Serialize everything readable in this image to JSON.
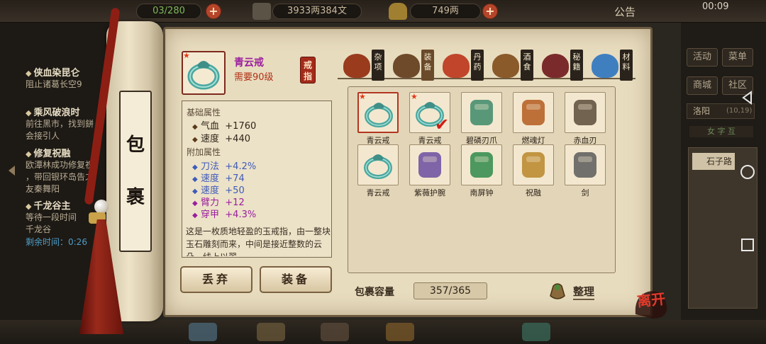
{
  "topbar": {
    "pill1_value": "03/280",
    "money": "3933两384文",
    "gold": "749两",
    "notice": "公告",
    "time": "00:09"
  },
  "quests": [
    {
      "title": "侠血染昆仑",
      "lines": [
        "阻止诸葛长空9"
      ]
    },
    {
      "title": "乘风破浪时",
      "lines": [
        "前往黑市，找到鉼",
        "会接引人"
      ]
    },
    {
      "title": "修复祝融",
      "lines": [
        "欧潭林成功修复祝",
        "，带回银环岛告之",
        "友秦舞阳"
      ]
    },
    {
      "title": "千龙谷主",
      "lines": [
        "等待一段时间",
        "千龙谷"
      ],
      "remain": "剩余时间：0:26"
    }
  ],
  "right_panel": {
    "buttons": [
      "活动",
      "菜单",
      "商城",
      "社区"
    ],
    "location": "洛阳",
    "coords": "(10,19)",
    "tabs": "女 字 互",
    "road": "石子路"
  },
  "scroll": {
    "chars": [
      "包",
      "裹"
    ]
  },
  "item": {
    "name": "青云戒",
    "level_req": "需要90级",
    "type_tag": "戒指",
    "base_header": "基础属性",
    "base_attrs": [
      {
        "name": "气血",
        "value": "+1760"
      },
      {
        "name": "速度",
        "value": "+440"
      }
    ],
    "extra_header": "附加属性",
    "extra_attrs": [
      {
        "name": "刀法",
        "value": "+4.2%",
        "color": "#3f5bb8"
      },
      {
        "name": "速度",
        "value": "+74",
        "color": "#3f5bb8"
      },
      {
        "name": "速度",
        "value": "+50",
        "color": "#3f5bb8"
      },
      {
        "name": "臂力",
        "value": "+12",
        "color": "#9a1e9e"
      },
      {
        "name": "穿甲",
        "value": "+4.3%",
        "color": "#9a1e9e"
      }
    ],
    "description": "这是一枚质地轻盈的玉戒指，由一整块玉石雕刻而来，中间是接近整数的云朵，线上以翠"
  },
  "buttons": {
    "discard": "丢弃",
    "equip": "装备"
  },
  "categories": [
    {
      "label": "杂项",
      "icon": "misc-jar-icon",
      "color": "#9a3b1e"
    },
    {
      "label": "装备",
      "icon": "equipment-weapons-icon",
      "color": "#6e4a2a",
      "active": true
    },
    {
      "label": "丹药",
      "icon": "pill-icon",
      "color": "#c0452a"
    },
    {
      "label": "酒食",
      "icon": "wine-food-icon",
      "color": "#8a5a2a"
    },
    {
      "label": "秘籍",
      "icon": "book-icon",
      "color": "#7a2a2a"
    },
    {
      "label": "材料",
      "icon": "crystal-icon",
      "color": "#3f7fc0"
    }
  ],
  "inventory": [
    {
      "name": "青云戒",
      "icon": "jade-ring-icon",
      "color": "#4aa7a0",
      "star": true,
      "selected": true
    },
    {
      "name": "青云戒",
      "icon": "jade-ring-icon",
      "color": "#4aa7a0",
      "star": true,
      "equipped": true
    },
    {
      "name": "碧磷刃爪",
      "icon": "claw-icon",
      "color": "#3c8a6a"
    },
    {
      "name": "燃魂灯",
      "icon": "lantern-icon",
      "color": "#b45a1e"
    },
    {
      "name": "赤血刃",
      "icon": "blade-icon",
      "color": "#5a4a3a"
    },
    {
      "name": "青云戒",
      "icon": "jade-ring-icon",
      "color": "#4aa7a0"
    },
    {
      "name": "紫薇护腕",
      "icon": "bracer-icon",
      "color": "#6a4ea0"
    },
    {
      "name": "南屏钟",
      "icon": "bell-icon",
      "color": "#2e8a4a"
    },
    {
      "name": "祝融",
      "icon": "ornament-icon",
      "color": "#b8862a"
    },
    {
      "name": "剑",
      "icon": "sword-icon",
      "color": "#5a5a5a"
    }
  ],
  "capacity": {
    "label": "包裹容量",
    "value": "357/365"
  },
  "sort_label": "整理",
  "leave_label": "离开",
  "bottom_icons": [
    "ring-menu-icon",
    "scroll-menu-icon",
    "boat-menu-icon",
    "sack-menu-icon",
    "map-menu-icon"
  ]
}
